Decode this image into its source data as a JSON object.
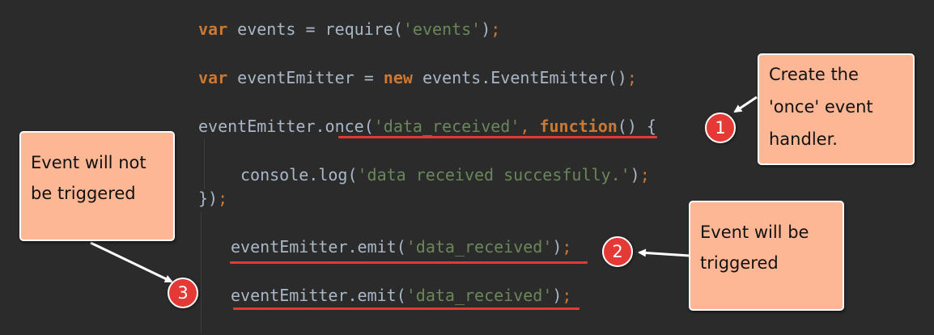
{
  "code": {
    "line1": {
      "kw_var": "var",
      "text1": " events = require(",
      "str": "'events'",
      "text2": ")",
      "semi": ";"
    },
    "line2": {
      "kw_var": "var",
      "text1": " eventEmitter = ",
      "kw_new": "new",
      "text2": " events.EventEmitter()",
      "semi": ";"
    },
    "line3": {
      "text1": "eventEmitter.once(",
      "str": "'data_received'",
      "comma": ", ",
      "kw_function": "function",
      "text2": "() {"
    },
    "line4": {
      "text1": "console.log(",
      "str": "'data received succesfully.'",
      "text2": ")",
      "semi": ";"
    },
    "line5": {
      "text1": "})",
      "semi": ";"
    },
    "line6": {
      "text1": "eventEmitter.emit(",
      "str": "'data_received'",
      "text2": ")",
      "semi": ";"
    },
    "line7": {
      "text1": "eventEmitter.emit(",
      "str": "'data_received'",
      "text2": ")",
      "semi": ";"
    }
  },
  "callouts": {
    "once_handler": [
      "Create the",
      "'once' event",
      "handler."
    ],
    "not_triggered": [
      "Event will not",
      "be triggered"
    ],
    "triggered": [
      "Event will be",
      "triggered"
    ]
  },
  "badges": {
    "one": "1",
    "two": "2",
    "three": "3"
  },
  "colors": {
    "background": "#2b2b2b",
    "keyword": "#cc7832",
    "string": "#6a8759",
    "plain": "#a9b7c6",
    "underline": "#e53935",
    "callout_fill": "#fdb794",
    "badge_fill": "#e53935"
  }
}
